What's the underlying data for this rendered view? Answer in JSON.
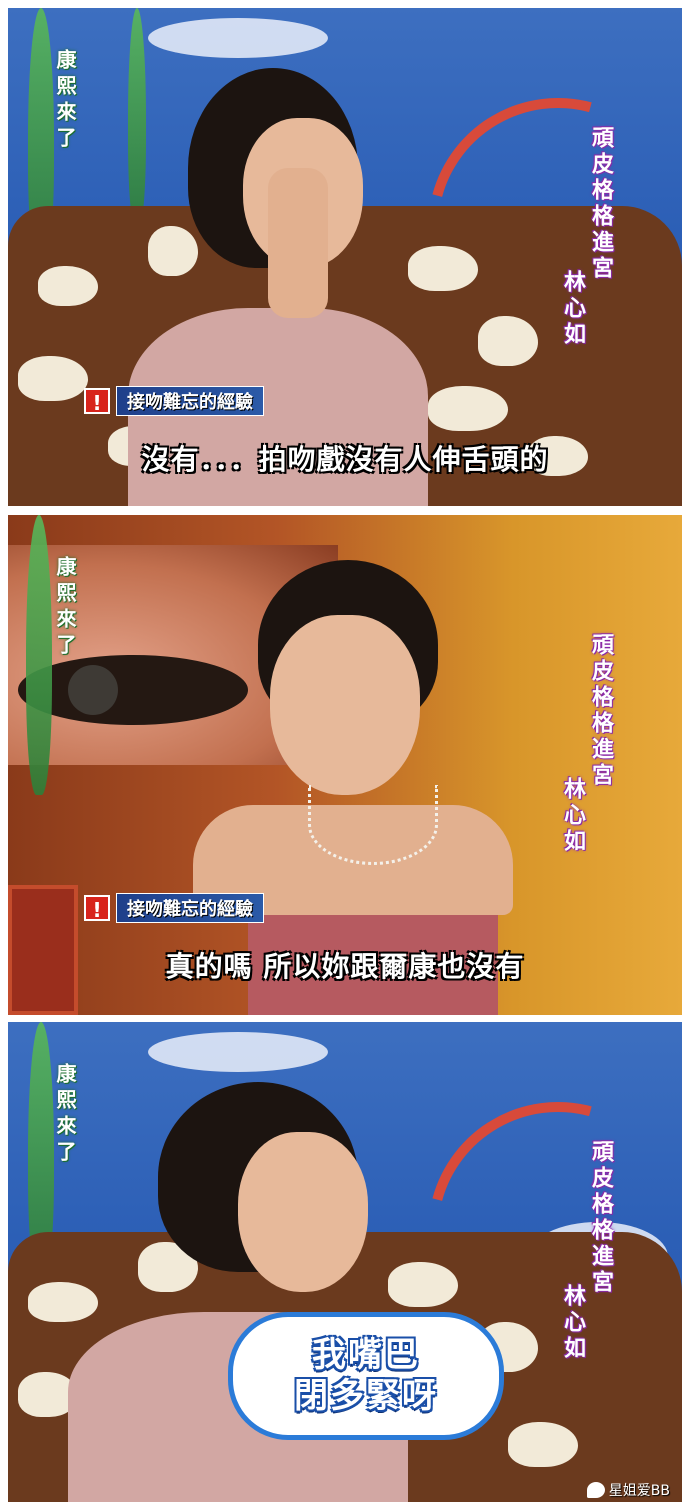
{
  "panels": [
    {
      "logo": "康熙來了",
      "show_title": "頑皮格格進宮",
      "guest_name": "林心如",
      "topic_mark": "!",
      "topic": "接吻難忘的經驗",
      "subtitle": "沒有．．．拍吻戲沒有人伸舌頭的"
    },
    {
      "logo": "康熙來了",
      "show_title": "頑皮格格進宮",
      "guest_name": "林心如",
      "topic_mark": "!",
      "topic": "接吻難忘的經驗",
      "subtitle": "真的嗎 所以妳跟爾康也沒有"
    },
    {
      "logo": "康熙來了",
      "show_title": "頑皮格格進宮",
      "guest_name": "林心如",
      "bubble_line1": "我嘴巴",
      "bubble_line2": "閉多緊呀"
    }
  ],
  "watermark": "星姐爱BB",
  "colors": {
    "topic_mark": "#d8241c",
    "bubble_border": "#2b7bd8",
    "title_outline": "#8a2aa8",
    "logo_outline": "#1a6e2a"
  },
  "icons": [
    "wechat-icon"
  ]
}
